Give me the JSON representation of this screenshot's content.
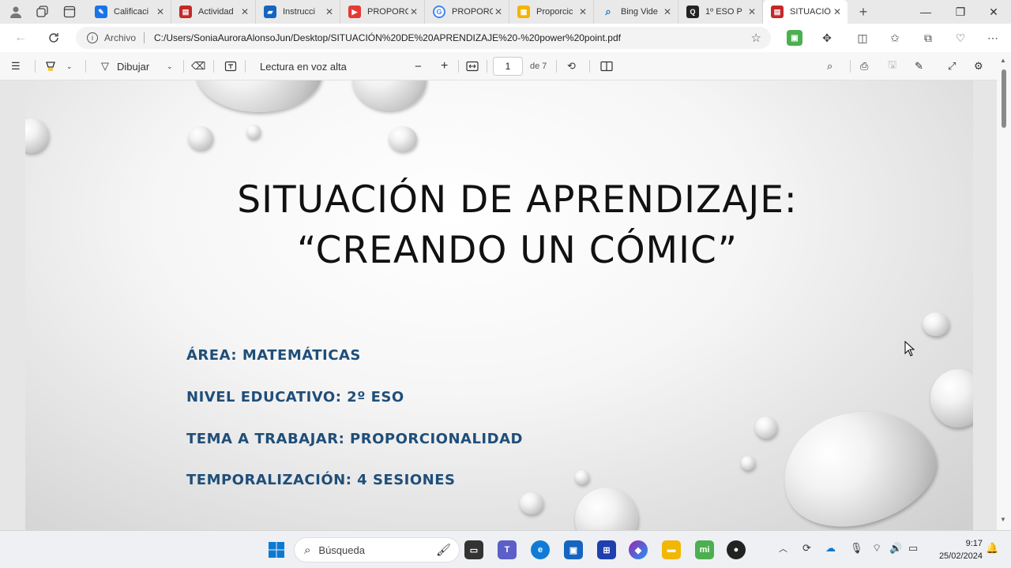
{
  "browser": {
    "tabs": [
      {
        "title": "Calificaci",
        "favicon": "classroom-icon",
        "color": "#1a73e8"
      },
      {
        "title": "Actividad",
        "favicon": "pdf-icon",
        "color": "#c62828"
      },
      {
        "title": "Instrucci",
        "favicon": "classroom-icon",
        "color": "#1565c0"
      },
      {
        "title": "PROPORC",
        "favicon": "youtube-icon",
        "color": "#e53935"
      },
      {
        "title": "PROPORC",
        "favicon": "google-icon",
        "color": "#4285f4"
      },
      {
        "title": "Proporcic",
        "favicon": "slides-icon",
        "color": "#f4b400"
      },
      {
        "title": "Bing Vide",
        "favicon": "bing-search-icon",
        "color": "#1976d2"
      },
      {
        "title": "1º ESO P",
        "favicon": "quizizz-icon",
        "color": "#222222"
      },
      {
        "title": "SITUACIÓ",
        "favicon": "pdf-icon",
        "color": "#c62828",
        "active": true
      }
    ],
    "address": {
      "label": "Archivo",
      "url": "C:/Users/SoniaAuroraAlonsoJun/Desktop/SITUACIÓN%20DE%20APRENDIZAJE%20-%20power%20point.pdf"
    }
  },
  "pdf_toolbar": {
    "draw_label": "Dibujar",
    "read_aloud_label": "Lectura en voz alta",
    "page_current": "1",
    "page_total": "de 7"
  },
  "slide": {
    "title_line1": "SITUACIÓN DE APRENDIZAJE:",
    "title_line2": "“CREANDO UN CÓMIC”",
    "area": "ÁREA:  MATEMÁTICAS",
    "nivel": "NIVEL EDUCATIVO: 2º ESO",
    "tema": "TEMA A TRABAJAR: PROPORCIONALIDAD",
    "temporalizacion": "TEMPORALIZACIÓN: 4 SESIONES",
    "accent_color": "#1f4e79"
  },
  "taskbar": {
    "search_label": "Búsqueda",
    "time": "9:17",
    "date": "25/02/2024"
  }
}
